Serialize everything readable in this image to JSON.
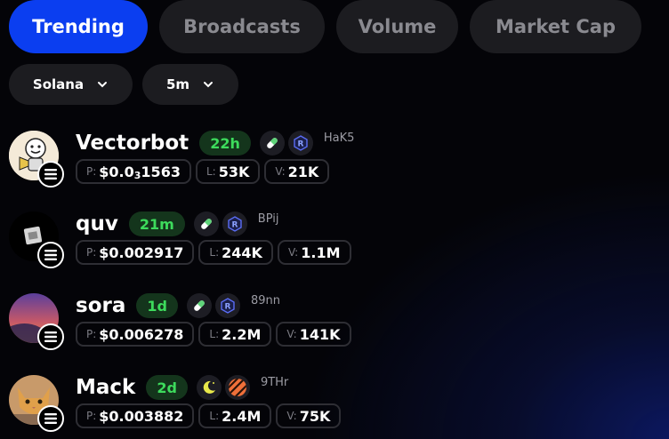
{
  "tabs": [
    {
      "label": "Trending",
      "active": true
    },
    {
      "label": "Broadcasts",
      "active": false
    },
    {
      "label": "Volume",
      "active": false
    },
    {
      "label": "Market Cap",
      "active": false
    }
  ],
  "filters": {
    "chain": "Solana",
    "timeframe": "5m"
  },
  "stat_keys": {
    "price": "P:",
    "liquidity": "L:",
    "volume": "V:"
  },
  "tokens": [
    {
      "name": "Vectorbot",
      "age": "22h",
      "address": "HaK5",
      "price_prefix": "$0.0",
      "price_zeros": "3",
      "price_digits": "1563",
      "liquidity": "53K",
      "volume": "21K",
      "platforms": [
        "pill-icon",
        "raydium-icon"
      ]
    },
    {
      "name": "quv",
      "age": "21m",
      "address": "BPij",
      "price": "$0.002917",
      "liquidity": "244K",
      "volume": "1.1M",
      "platforms": [
        "pill-icon",
        "raydium-icon"
      ]
    },
    {
      "name": "sora",
      "age": "1d",
      "address": "89nn",
      "price": "$0.006278",
      "liquidity": "2.2M",
      "volume": "141K",
      "platforms": [
        "pill-icon",
        "raydium-icon"
      ]
    },
    {
      "name": "Mack",
      "age": "2d",
      "address": "9THr",
      "price": "$0.003882",
      "liquidity": "2.4M",
      "volume": "75K",
      "platforms": [
        "moon-icon",
        "striped-launchpad-icon"
      ]
    }
  ],
  "colors": {
    "accent": "#0b3ef0",
    "age_text": "#3ddb5c",
    "age_bg": "#14351c",
    "chip_bg": "#1c1c20"
  }
}
